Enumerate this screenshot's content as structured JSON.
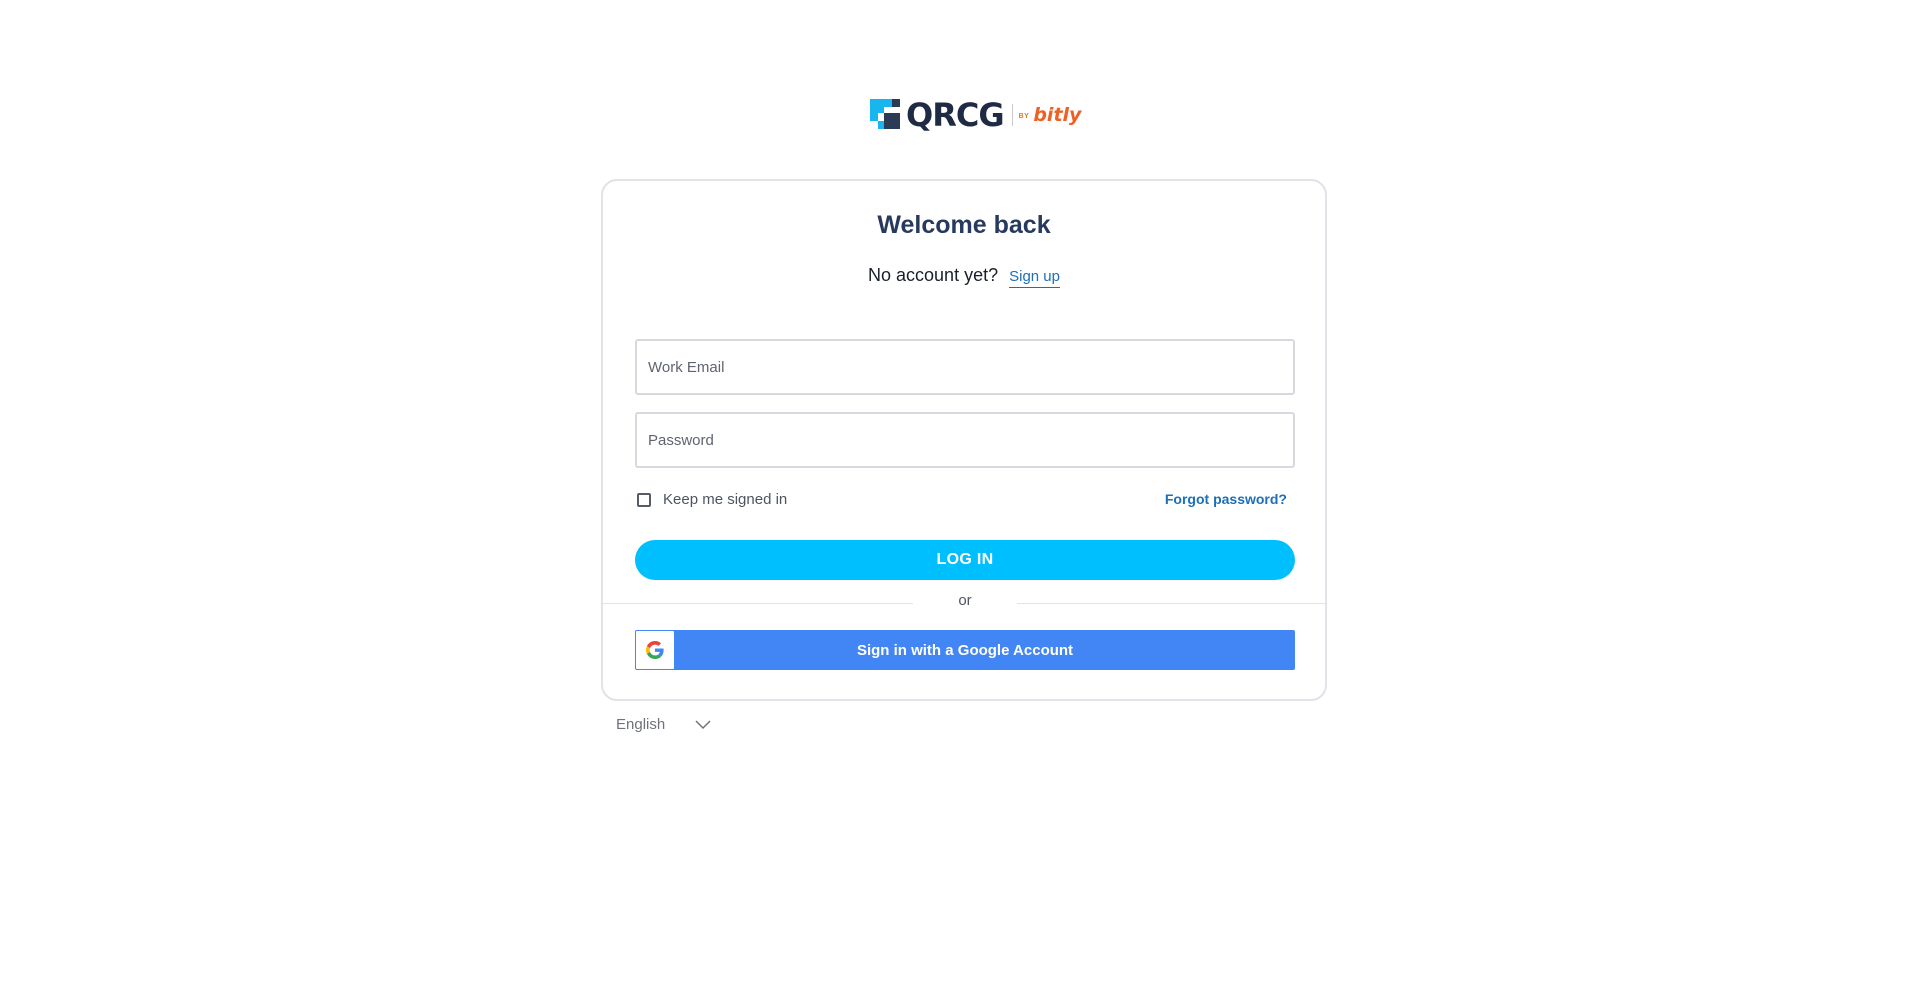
{
  "logo": {
    "brand": "QRCG",
    "by": "BY",
    "partner": "bitly"
  },
  "card": {
    "title": "Welcome back",
    "no_account_text": "No account yet?",
    "signup_link": "Sign up",
    "email_placeholder": "Work Email",
    "password_placeholder": "Password",
    "remember_label": "Keep me signed in",
    "remember_checked": false,
    "forgot_link": "Forgot password?",
    "login_button": "LOG IN",
    "or_text": "or",
    "google_button": "Sign in with a Google Account"
  },
  "language": {
    "selected": "English"
  },
  "colors": {
    "primary": "#00bfff",
    "google": "#4285f4",
    "link": "#1c6fb8",
    "title": "#273a5e",
    "brand_orange": "#ee6123"
  }
}
